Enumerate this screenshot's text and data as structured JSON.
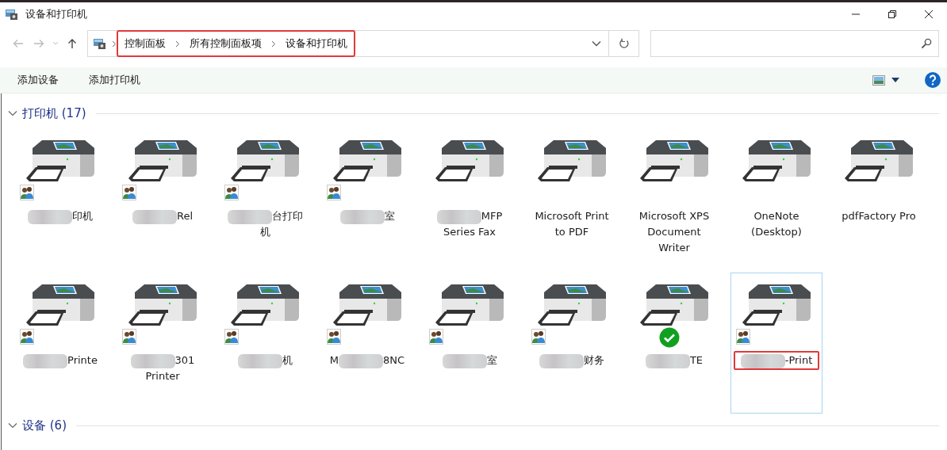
{
  "window": {
    "title": "设备和打印机"
  },
  "address_bar": {
    "highlighted": true,
    "path": [
      "控制面板",
      "所有控制面板项",
      "设备和打印机"
    ]
  },
  "command_bar": {
    "buttons": [
      "添加设备",
      "添加打印机"
    ]
  },
  "sections": [
    {
      "title": "打印机 (17)",
      "expanded": true,
      "items": [
        {
          "shared": true,
          "is_default": false,
          "selected": false,
          "highlighted": false,
          "label_parts": [
            {
              "kind": "blur"
            },
            {
              "kind": "text",
              "text": "印机"
            }
          ]
        },
        {
          "shared": true,
          "is_default": false,
          "selected": false,
          "highlighted": false,
          "label_parts": [
            {
              "kind": "blur"
            },
            {
              "kind": "text",
              "text": "Rel"
            }
          ]
        },
        {
          "shared": true,
          "is_default": false,
          "selected": false,
          "highlighted": false,
          "label_parts": [
            {
              "kind": "blur"
            },
            {
              "kind": "text",
              "text": "台打印机"
            }
          ]
        },
        {
          "shared": true,
          "is_default": false,
          "selected": false,
          "highlighted": false,
          "label_parts": [
            {
              "kind": "blur"
            },
            {
              "kind": "text",
              "text": "室"
            }
          ]
        },
        {
          "shared": false,
          "is_default": false,
          "selected": false,
          "highlighted": false,
          "label_parts": [
            {
              "kind": "blur"
            },
            {
              "kind": "text",
              "text": "MFP Series Fax"
            }
          ]
        },
        {
          "shared": false,
          "is_default": false,
          "selected": false,
          "highlighted": false,
          "label_parts": [
            {
              "kind": "text",
              "text": "Microsoft Print to PDF"
            }
          ]
        },
        {
          "shared": false,
          "is_default": false,
          "selected": false,
          "highlighted": false,
          "label_parts": [
            {
              "kind": "text",
              "text": "Microsoft XPS Document Writer"
            }
          ]
        },
        {
          "shared": false,
          "is_default": false,
          "selected": false,
          "highlighted": false,
          "label_parts": [
            {
              "kind": "text",
              "text": "OneNote (Desktop)"
            }
          ]
        },
        {
          "shared": false,
          "is_default": false,
          "selected": false,
          "highlighted": false,
          "label_parts": [
            {
              "kind": "text",
              "text": "pdfFactory Pro"
            }
          ]
        },
        {
          "shared": true,
          "is_default": false,
          "selected": false,
          "highlighted": false,
          "label_parts": [
            {
              "kind": "blur"
            },
            {
              "kind": "text",
              "text": "Printe"
            }
          ]
        },
        {
          "shared": true,
          "is_default": false,
          "selected": false,
          "highlighted": false,
          "label_parts": [
            {
              "kind": "blur"
            },
            {
              "kind": "text",
              "text": "301 Printer"
            }
          ]
        },
        {
          "shared": true,
          "is_default": false,
          "selected": false,
          "highlighted": false,
          "label_parts": [
            {
              "kind": "blur"
            },
            {
              "kind": "text",
              "text": "机"
            }
          ]
        },
        {
          "shared": true,
          "is_default": false,
          "selected": false,
          "highlighted": false,
          "label_parts": [
            {
              "kind": "text",
              "text": "M"
            },
            {
              "kind": "blur"
            },
            {
              "kind": "text",
              "text": "8NC"
            }
          ]
        },
        {
          "shared": true,
          "is_default": false,
          "selected": false,
          "highlighted": false,
          "label_parts": [
            {
              "kind": "blur"
            },
            {
              "kind": "text",
              "text": "室"
            }
          ]
        },
        {
          "shared": true,
          "is_default": false,
          "selected": false,
          "highlighted": false,
          "label_parts": [
            {
              "kind": "blur"
            },
            {
              "kind": "text",
              "text": "财务"
            }
          ]
        },
        {
          "shared": false,
          "is_default": true,
          "selected": false,
          "highlighted": false,
          "label_parts": [
            {
              "kind": "blur"
            },
            {
              "kind": "text",
              "text": "TE"
            }
          ]
        },
        {
          "shared": true,
          "is_default": false,
          "selected": true,
          "highlighted": true,
          "label_parts": [
            {
              "kind": "blur"
            },
            {
              "kind": "text",
              "text": "-Print"
            }
          ]
        }
      ]
    },
    {
      "title": "设备 (6)",
      "expanded": true
    }
  ]
}
